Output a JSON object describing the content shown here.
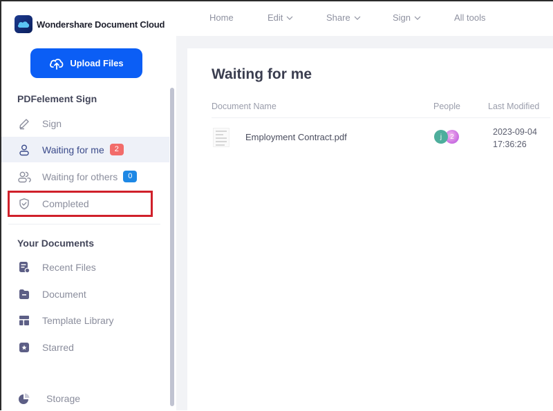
{
  "app": {
    "brand_name": "Wondershare Document Cloud",
    "upload_button": "Upload Files"
  },
  "sidebar": {
    "sign_section": {
      "title": "PDFelement Sign",
      "items": [
        {
          "label": "Sign",
          "icon": "pen-icon"
        },
        {
          "label": "Waiting for me",
          "icon": "user-icon",
          "badge": "2",
          "active": true
        },
        {
          "label": "Waiting for others",
          "icon": "users-icon",
          "badge": "0"
        },
        {
          "label": "Completed",
          "icon": "shield-check-icon",
          "highlighted": true
        }
      ]
    },
    "documents_section": {
      "title": "Your Documents",
      "items": [
        {
          "label": "Recent Files",
          "icon": "recent-file-icon"
        },
        {
          "label": "Document",
          "icon": "folder-icon"
        },
        {
          "label": "Template Library",
          "icon": "template-icon"
        },
        {
          "label": "Starred",
          "icon": "star-icon"
        }
      ]
    },
    "storage": {
      "label": "Storage",
      "icon": "pie-chart-icon"
    }
  },
  "topnav": {
    "items": [
      {
        "label": "Home",
        "dropdown": false
      },
      {
        "label": "Edit",
        "dropdown": true
      },
      {
        "label": "Share",
        "dropdown": true
      },
      {
        "label": "Sign",
        "dropdown": true
      },
      {
        "label": "All tools",
        "dropdown": false
      }
    ]
  },
  "main": {
    "title": "Waiting for me",
    "columns": [
      "Document Name",
      "People",
      "Last Modified"
    ],
    "rows": [
      {
        "name": "Employment Contract.pdf",
        "people": [
          "j",
          "2"
        ],
        "modified_date": "2023-09-04",
        "modified_time": "17:36:26"
      }
    ]
  },
  "colors": {
    "accent": "#0b5ef5",
    "badge_red": "#f26c6a",
    "badge_blue": "#1e88e5",
    "highlight_box": "#d0202a"
  }
}
